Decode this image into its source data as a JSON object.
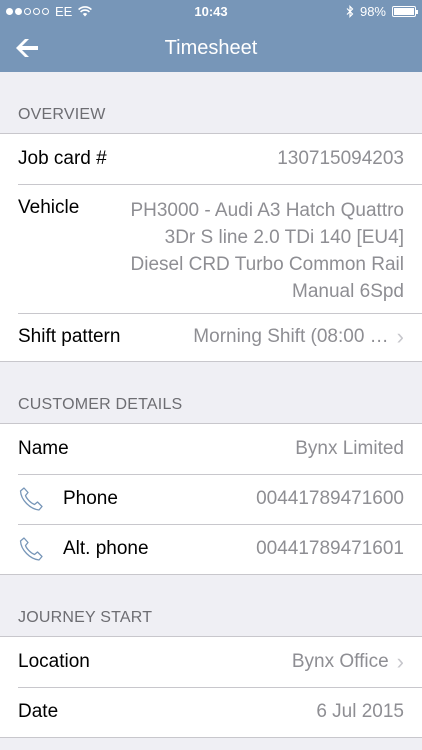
{
  "status_bar": {
    "carrier": "EE",
    "time": "10:43",
    "battery": "98%",
    "battery_level": 0.98,
    "signal_bars": 2
  },
  "nav": {
    "title": "Timesheet",
    "back_icon": "arrow-left-icon"
  },
  "overview": {
    "header": "OVERVIEW",
    "job_card": {
      "label": "Job card #",
      "value": "130715094203"
    },
    "vehicle": {
      "label": "Vehicle",
      "value": "PH3000 - Audi A3 Hatch Quattro 3Dr S line 2.0 TDi 140 [EU4] Diesel CRD Turbo Common Rail Manual 6Spd"
    },
    "shift": {
      "label": "Shift pattern",
      "value": "Morning Shift (08:00 …"
    }
  },
  "customer": {
    "header": "CUSTOMER DETAILS",
    "name": {
      "label": "Name",
      "value": "Bynx Limited"
    },
    "phone": {
      "label": "Phone",
      "value": "00441789471600",
      "icon": "phone-icon"
    },
    "alt_phone": {
      "label": "Alt. phone",
      "value": "00441789471601",
      "icon": "phone-icon"
    }
  },
  "journey": {
    "header": "JOURNEY START",
    "location": {
      "label": "Location",
      "value": "Bynx Office"
    },
    "date": {
      "label": "Date",
      "value": "6 Jul 2015"
    }
  },
  "colors": {
    "navbar": "#7796b8",
    "background": "#efeff4",
    "secondary_text": "#8e8e93",
    "header_text": "#6d6d72",
    "separator": "#c8c7cc"
  }
}
